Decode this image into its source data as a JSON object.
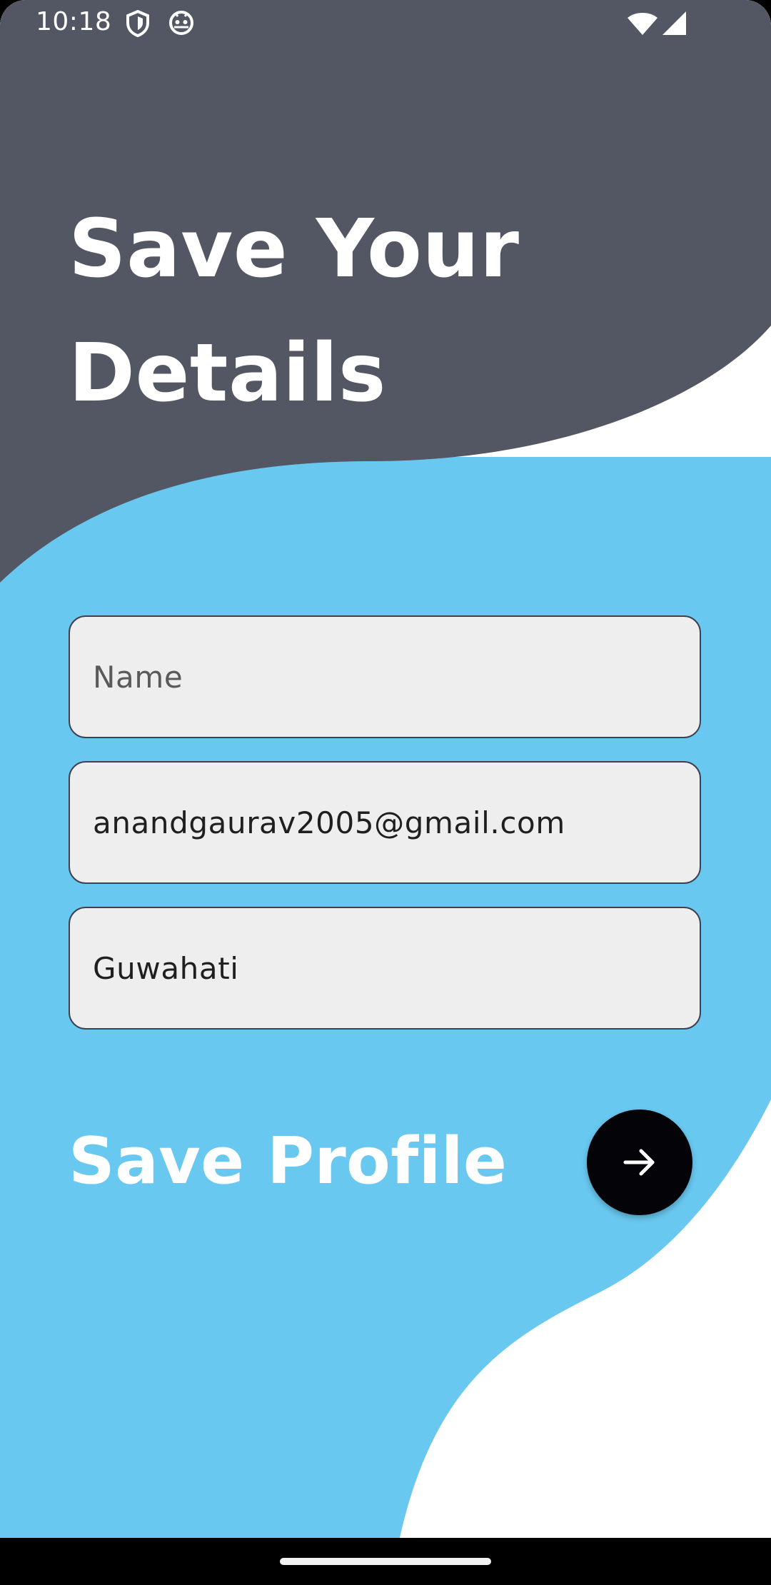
{
  "colors": {
    "dark_wave": "#535663",
    "light_wave": "#69c8f0",
    "background": "#ffffff",
    "button": "#040408",
    "field_fill": "#eeeeee",
    "field_border": "#3e4150"
  },
  "status_bar": {
    "time": "10:18",
    "icons": [
      "shield-icon",
      "android-bug-icon",
      "wifi-icon",
      "cell-signal-icon"
    ]
  },
  "page": {
    "title_line1": "Save Your",
    "title_line2": "Details"
  },
  "form": {
    "name": {
      "placeholder": "Name",
      "value": ""
    },
    "email": {
      "placeholder": "",
      "value": "anandgaurav2005@gmail.com"
    },
    "city": {
      "placeholder": "",
      "value": "Guwahati"
    }
  },
  "save": {
    "label": "Save Profile",
    "button_icon": "arrow-right-icon"
  },
  "nav_bar": {
    "handle": "gesture-handle"
  }
}
